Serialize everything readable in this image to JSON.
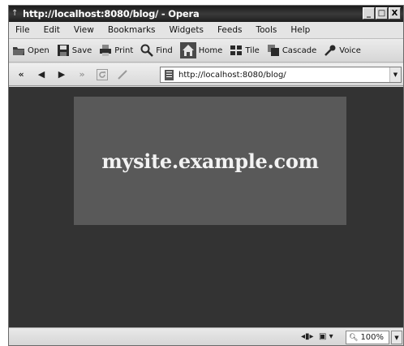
{
  "window": {
    "title": "http://localhost:8080/blog/ - Opera",
    "controls": {
      "minimize": "_",
      "maximize": "□",
      "close": "X"
    }
  },
  "menubar": {
    "items": [
      {
        "label": "File"
      },
      {
        "label": "Edit"
      },
      {
        "label": "View"
      },
      {
        "label": "Bookmarks"
      },
      {
        "label": "Widgets"
      },
      {
        "label": "Feeds"
      },
      {
        "label": "Tools"
      },
      {
        "label": "Help"
      }
    ]
  },
  "toolbar": {
    "buttons": [
      {
        "label": "Open",
        "icon": "folder-icon"
      },
      {
        "label": "Save",
        "icon": "floppy-icon"
      },
      {
        "label": "Print",
        "icon": "printer-icon"
      },
      {
        "label": "Find",
        "icon": "magnifier-icon"
      },
      {
        "label": "Home",
        "icon": "home-icon"
      },
      {
        "label": "Tile",
        "icon": "tile-icon"
      },
      {
        "label": "Cascade",
        "icon": "cascade-icon"
      },
      {
        "label": "Voice",
        "icon": "microphone-icon"
      }
    ]
  },
  "addressbar": {
    "nav": {
      "rewind": "«",
      "back": "◀",
      "forward": "▶",
      "fast_forward": "»"
    },
    "url": "http://localhost:8080/blog/"
  },
  "content": {
    "heading": "mysite.example.com"
  },
  "statusbar": {
    "zoom": "100%"
  }
}
